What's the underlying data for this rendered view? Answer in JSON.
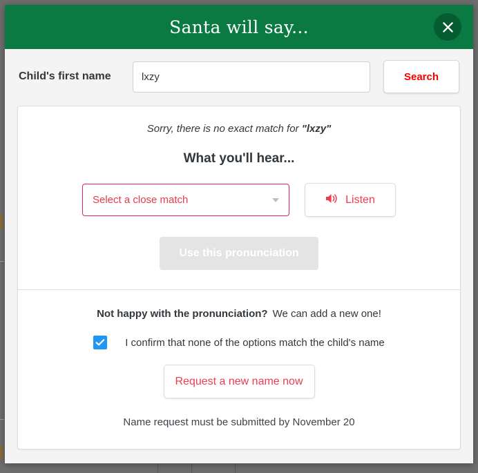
{
  "modal": {
    "title": "Santa will say...",
    "close_icon_label": "close-icon"
  },
  "search": {
    "label": "Child's first name",
    "input_value": "lxzy",
    "input_placeholder": "",
    "button_label": "Search"
  },
  "pronunciation": {
    "no_match_prefix": "Sorry, there is no exact match for ",
    "no_match_name": "\"lxzy\"",
    "heading": "What you'll hear...",
    "select_value": "Select a close match",
    "listen_label": "Listen",
    "use_pronunciation_label": "Use this pronunciation"
  },
  "request": {
    "not_happy_bold": "Not happy with the pronunciation?",
    "not_happy_rest": "We can add a new one!",
    "confirm_label": "I confirm that none of the options match the child's name",
    "confirm_checked": true,
    "request_button_label": "Request a new name now",
    "deadline_note": "Name request must be submitted by November 20"
  },
  "colors": {
    "header_green": "#0a7a42",
    "close_circle_green": "#065c31",
    "accent_red": "#ee3b50",
    "search_red": "#f50000",
    "select_border_red": "#e0245e",
    "checkbox_blue": "#2196f3",
    "disabled_gray": "#e4e4e4",
    "backdrop_gray": "#6e6e6e",
    "modal_bg": "#f4f4f4"
  }
}
